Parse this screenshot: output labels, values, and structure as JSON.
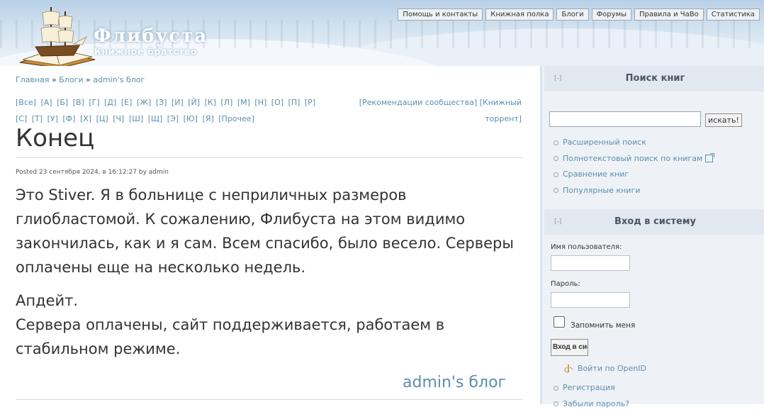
{
  "header": {
    "site_name": "Флибуста",
    "slogan": "Книжное братство",
    "nav": [
      "Помощь и контакты",
      "Книжная полка",
      "Блоги",
      "Форумы",
      "Правила и ЧаВо",
      "Статистика"
    ]
  },
  "breadcrumb": {
    "home": "Главная",
    "sep": "»",
    "blogs": "Блоги",
    "current": "admin's блог"
  },
  "letters": [
    "[Все]",
    "[А]",
    "[Б]",
    "[В]",
    "[Г]",
    "[Д]",
    "[Е]",
    "[Ж]",
    "[З]",
    "[И]",
    "[Й]",
    "[К]",
    "[Л]",
    "[М]",
    "[Н]",
    "[О]",
    "[П]",
    "[Р]",
    "[С]",
    "[Т]",
    "[У]",
    "[Ф]",
    "[Х]",
    "[Ц]",
    "[Ч]",
    "[Ш]",
    "[Щ]",
    "[Э]",
    "[Ю]",
    "[Я]",
    "[Прочее]"
  ],
  "rec_links": {
    "recommendations": "[Рекомендации сообщества]",
    "torrent": "[Книжный торрент]"
  },
  "post": {
    "title": "Конец",
    "submitted": "Posted 23 сентября 2024, в 16:12:27 by admin",
    "paragraphs": [
      "Это Stiver. Я в больнице с неприличных размеров глиобластомой. К сожалению, Флибуста на этом видимо закончилась, как и я сам. Всем спасибо, было весело. Серверы оплачены еще на несколько недель.",
      "Апдейт.\nСервера оплачены, сайт поддерживается, работаем в стабильном режиме."
    ],
    "blog_link": "admin's блог"
  },
  "sidebar": {
    "collapse_glyph": "[-]",
    "search": {
      "title": "Поиск книг",
      "button": "искать!",
      "links": [
        "Расширенный поиск",
        "Полнотекстовый поиск по книгам",
        "Сравнение книг",
        "Популярные книги"
      ]
    },
    "login": {
      "title": "Вход в систему",
      "username_label": "Имя пользователя:",
      "password_label": "Пароль:",
      "remember": "Запомнить меня",
      "submit": "Вход в систему",
      "openid": "Войти по OpenID",
      "links": [
        "Регистрация",
        "Забыли пароль?"
      ]
    }
  },
  "colors": {
    "link": "#5a8eb0",
    "sidebar_bg": "#eef2f6",
    "block_header_bg": "#e1e8ef",
    "text": "#333333"
  }
}
